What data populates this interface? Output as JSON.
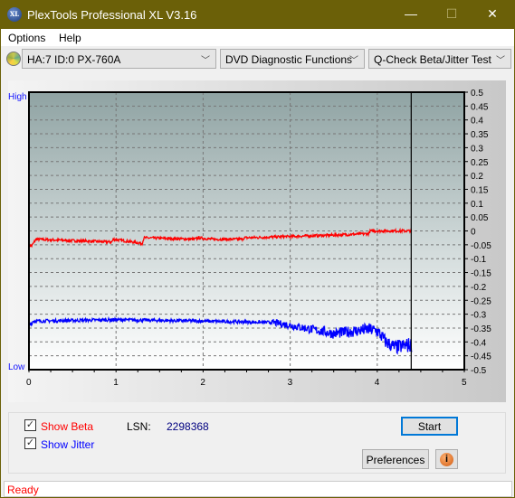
{
  "window": {
    "title": "PlexTools Professional XL V3.16",
    "logo_text": "XL",
    "minimize": "—",
    "maximize": "☐",
    "close": "✕"
  },
  "menu": [
    {
      "label": "Options"
    },
    {
      "label": "Help"
    }
  ],
  "toolbar": {
    "drive": "HA:7 ID:0  PX-760A",
    "function": "DVD Diagnostic Functions",
    "test": "Q-Check Beta/Jitter Test"
  },
  "chart_data": {
    "type": "line",
    "left_labels": {
      "high": "High",
      "low": "Low"
    },
    "xlim": [
      0,
      5
    ],
    "ylim": [
      -0.5,
      0.5
    ],
    "x_ticks": [
      "0",
      "1",
      "2",
      "3",
      "4",
      "5"
    ],
    "y_ticks": [
      "0.5",
      "0.45",
      "0.4",
      "0.35",
      "0.3",
      "0.25",
      "0.2",
      "0.15",
      "0.1",
      "0.05",
      "0",
      "-0.05",
      "-0.1",
      "-0.15",
      "-0.2",
      "-0.25",
      "-0.3",
      "-0.35",
      "-0.4",
      "-0.45",
      "-0.5"
    ],
    "grid": true,
    "cursor_x": 4.39,
    "series": [
      {
        "key": "beta",
        "color": "#ff0000",
        "points": [
          [
            0,
            -0.05
          ],
          [
            0.03,
            -0.055
          ],
          [
            0.08,
            -0.03
          ],
          [
            0.5,
            -0.035
          ],
          [
            0.95,
            -0.04
          ],
          [
            0.97,
            -0.03
          ],
          [
            1.3,
            -0.045
          ],
          [
            1.32,
            -0.025
          ],
          [
            1.9,
            -0.03
          ],
          [
            1.95,
            -0.025
          ],
          [
            2.1,
            -0.03
          ],
          [
            2.45,
            -0.03
          ],
          [
            2.47,
            -0.025
          ],
          [
            3.0,
            -0.02
          ],
          [
            3.5,
            -0.015
          ],
          [
            3.9,
            -0.01
          ],
          [
            3.92,
            0
          ],
          [
            4.4,
            0
          ]
        ]
      },
      {
        "key": "jitter",
        "color": "#0000ff",
        "points": [
          [
            0,
            -0.34
          ],
          [
            0.05,
            -0.325
          ],
          [
            1,
            -0.32
          ],
          [
            2,
            -0.325
          ],
          [
            2.8,
            -0.33
          ],
          [
            3.0,
            -0.34
          ],
          [
            3.5,
            -0.37
          ],
          [
            3.9,
            -0.355
          ],
          [
            4.0,
            -0.36
          ],
          [
            4.1,
            -0.4
          ],
          [
            4.2,
            -0.42
          ],
          [
            4.4,
            -0.41
          ]
        ]
      }
    ]
  },
  "controls": {
    "show_beta": "Show Beta",
    "show_jitter": "Show Jitter",
    "beta_checked": true,
    "jitter_checked": true,
    "lsn_label": "LSN:",
    "lsn_value": "2298368",
    "start": "Start",
    "preferences": "Preferences",
    "info": "i"
  },
  "status": "Ready"
}
